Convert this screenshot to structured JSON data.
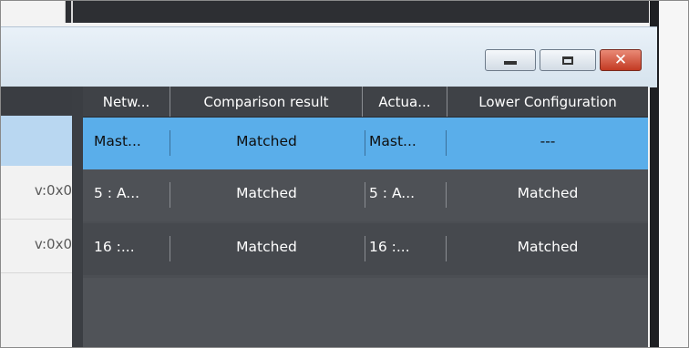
{
  "window": {
    "buttons": {
      "minimize": "minimize-icon",
      "maximize": "maximize-icon",
      "close": "close-icon"
    },
    "close_glyph": "✕"
  },
  "left_panel": {
    "rows": [
      {
        "text": "v:0x0"
      },
      {
        "text": "v:0x0"
      }
    ]
  },
  "grid": {
    "columns": [
      "Netw...",
      "Comparison result",
      "Actua...",
      "Lower Configuration"
    ],
    "rows": [
      {
        "network": "Mast...",
        "comparison": "Matched",
        "actual": "Mast...",
        "lower": "---"
      },
      {
        "network": "5 : A...",
        "comparison": "Matched",
        "actual": "5 : A...",
        "lower": "Matched"
      },
      {
        "network": "16 :...",
        "comparison": "Matched",
        "actual": "16 :...",
        "lower": "Matched"
      }
    ]
  },
  "colors": {
    "selected_row": "#5aaeea",
    "grid_bg": "#4b4e53",
    "header_bg": "#3f4247",
    "close_button": "#c33a23"
  }
}
